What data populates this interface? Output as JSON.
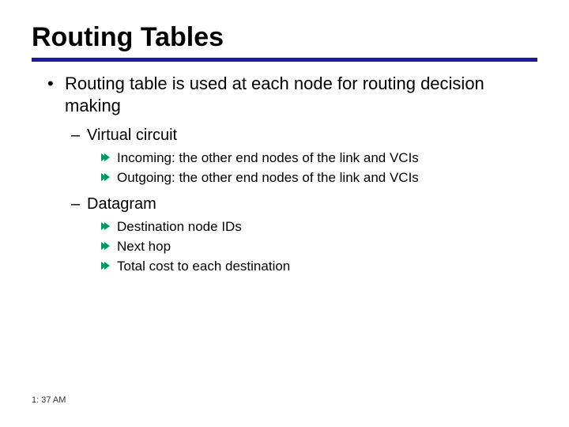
{
  "slide": {
    "title": "Routing Tables",
    "bullets": {
      "b1": "Routing table is used at each node for routing decision making",
      "b1a": "Virtual circuit",
      "b1a_i": "Incoming: the other end nodes of the link and VCIs",
      "b1a_ii": "Outgoing: the other end nodes of the link and VCIs",
      "b1b": "Datagram",
      "b1b_i": "Destination node IDs",
      "b1b_ii": "Next hop",
      "b1b_iii": "Total cost to each destination"
    },
    "timestamp": "1: 37 AM"
  },
  "colors": {
    "rule": "#1a1aa6",
    "arrow": "#009966"
  }
}
